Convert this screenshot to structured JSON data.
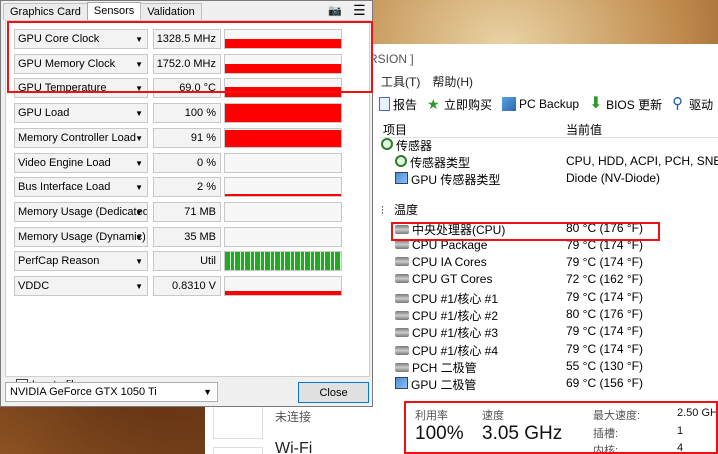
{
  "gpuz": {
    "tabs": [
      "Graphics Card",
      "Sensors",
      "Validation"
    ],
    "sensors": [
      {
        "name": "GPU Core Clock",
        "value": "1328.5 MHz",
        "graph_level": 0.5
      },
      {
        "name": "GPU Memory Clock",
        "value": "1752.0 MHz",
        "graph_level": 0.5
      },
      {
        "name": "GPU Temperature",
        "value": "69.0 °C",
        "graph_level": 0.6
      },
      {
        "name": "GPU Load",
        "value": "100 %",
        "graph_level": 1.0
      },
      {
        "name": "Memory Controller Load",
        "value": "91 %",
        "graph_level": 0.91
      },
      {
        "name": "Video Engine Load",
        "value": "0 %",
        "graph_level": 0.0
      },
      {
        "name": "Bus Interface Load",
        "value": "2 %",
        "graph_level": 0.02
      },
      {
        "name": "Memory Usage (Dedicated)",
        "value": "71 MB",
        "graph_level": 0.0
      },
      {
        "name": "Memory Usage (Dynamic)",
        "value": "35 MB",
        "graph_level": 0.0
      },
      {
        "name": "PerfCap Reason",
        "value": "Util",
        "graph_level": 1.0
      },
      {
        "name": "VDDC",
        "value": "0.8310 V",
        "graph_level": 0.2
      }
    ],
    "log_to_file": "Log to file",
    "gpu_selected": "NVIDIA GeForce GTX 1050 Ti",
    "close_label": "Close"
  },
  "aida": {
    "title": "RSION ]",
    "menu": [
      ")",
      "工具(T)",
      "帮助(H)"
    ],
    "toolbar": [
      "报告",
      "立即购买",
      "PC Backup",
      "BIOS 更新",
      "驱动"
    ],
    "headers": {
      "item": "项目",
      "value": "当前值"
    },
    "rows": [
      {
        "name": "传感器",
        "value": "",
        "icon": "sensor-icon",
        "indent": 0
      },
      {
        "name": "传感器类型",
        "value": "CPU, HDD, ACPI, PCH, SNB",
        "icon": "sensor-icon",
        "indent": 1
      },
      {
        "name": "GPU 传感器类型",
        "value": "Diode  (NV-Diode)",
        "icon": "gpu-icon",
        "indent": 1
      },
      {
        "name": "温度",
        "value": "",
        "icon": "thermometer-icon",
        "indent": 0
      },
      {
        "name": "中央处理器(CPU)",
        "value": "80 °C  (176 °F)",
        "icon": "chip-icon",
        "indent": 1
      },
      {
        "name": "CPU Package",
        "value": "79 °C  (174 °F)",
        "icon": "chip-icon",
        "indent": 1
      },
      {
        "name": "CPU IA Cores",
        "value": "79 °C  (174 °F)",
        "icon": "chip-icon",
        "indent": 1
      },
      {
        "name": "CPU GT Cores",
        "value": "72 °C  (162 °F)",
        "icon": "chip-icon",
        "indent": 1
      },
      {
        "name": "CPU #1/核心 #1",
        "value": "79 °C  (174 °F)",
        "icon": "chip-icon",
        "indent": 1
      },
      {
        "name": "CPU #1/核心 #2",
        "value": "80 °C  (176 °F)",
        "icon": "chip-icon",
        "indent": 1
      },
      {
        "name": "CPU #1/核心 #3",
        "value": "79 °C  (174 °F)",
        "icon": "chip-icon",
        "indent": 1
      },
      {
        "name": "CPU #1/核心 #4",
        "value": "79 °C  (174 °F)",
        "icon": "chip-icon",
        "indent": 1
      },
      {
        "name": "PCH 二极管",
        "value": "55 °C  (130 °F)",
        "icon": "chip-icon",
        "indent": 1
      },
      {
        "name": "GPU 二极管",
        "value": "69 °C  (156 °F)",
        "icon": "gpu-icon",
        "indent": 1
      }
    ]
  },
  "stats": {
    "util_label": "利用率",
    "util_value": "100%",
    "speed_label": "速度",
    "speed_value": "3.05 GHz",
    "max_speed_label": "最大速度:",
    "max_speed_value": "2.50 GH",
    "sockets_label": "插槽:",
    "sockets_value": "1",
    "cores_label": "内核:",
    "cores_value": "4"
  },
  "background": {
    "unconnected": "未连接",
    "wifi": "Wi-Fi"
  }
}
